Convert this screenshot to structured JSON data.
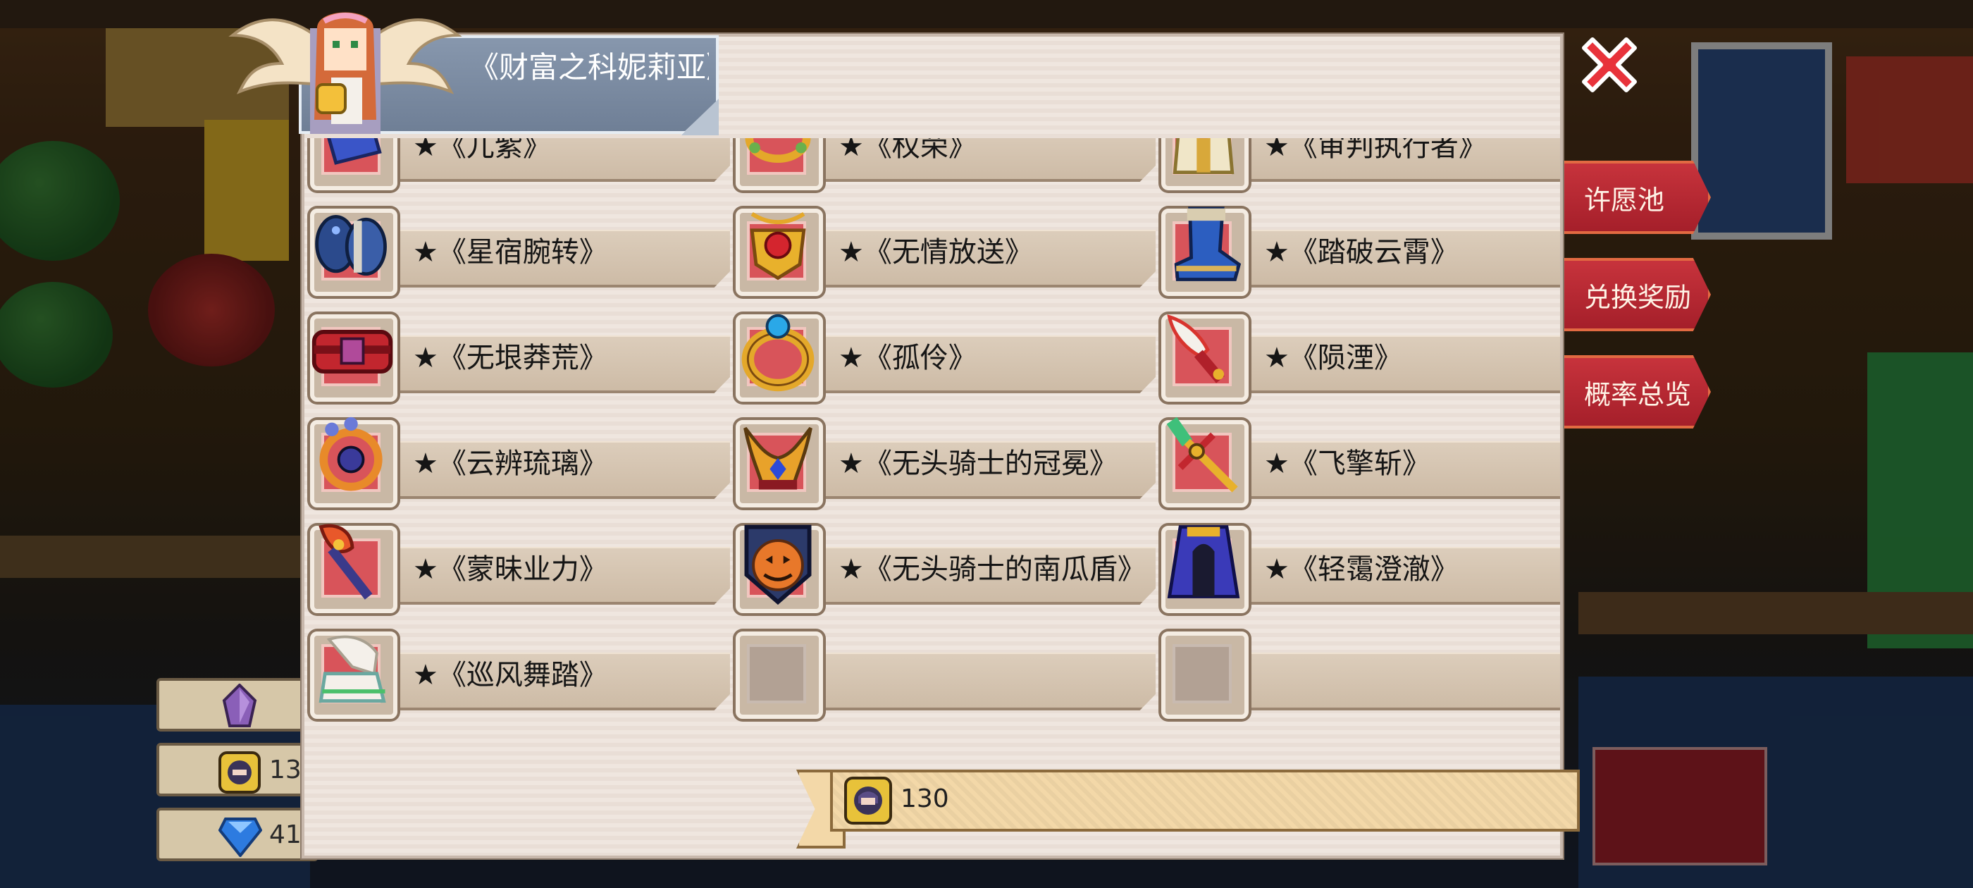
{
  "title": "《财富之科妮莉亚》",
  "side_buttons": [
    "许愿池",
    "兑换奖励",
    "概率总览"
  ],
  "resources": [
    {
      "icon": "purple-crystal-icon",
      "value": ""
    },
    {
      "icon": "coin-token-icon",
      "value": "13"
    },
    {
      "icon": "blue-gem-icon",
      "value": "41"
    }
  ],
  "items": [
    {
      "name": "★《兀紫》",
      "icon": "blue-lightning-fist-icon"
    },
    {
      "name": "★《权荣》",
      "icon": "golden-wreath-icon"
    },
    {
      "name": "★《审判执行者》",
      "icon": "armor-robe-icon"
    },
    {
      "name": "★《星宿腕转》",
      "icon": "blue-bracer-icon"
    },
    {
      "name": "★《无情放送》",
      "icon": "ruby-necklace-icon"
    },
    {
      "name": "★《踏破云霄》",
      "icon": "blue-boot-icon"
    },
    {
      "name": "★《无垠莽荒》",
      "icon": "red-belt-icon"
    },
    {
      "name": "★《孤伶》",
      "icon": "gold-ring-icon"
    },
    {
      "name": "★《陨湮》",
      "icon": "flame-dagger-icon"
    },
    {
      "name": "★《云辨琉璃》",
      "icon": "orange-amulet-icon"
    },
    {
      "name": "★《无头骑士的冠冕》",
      "icon": "horned-crown-icon"
    },
    {
      "name": "★《飞擎斩》",
      "icon": "jade-sword-icon"
    },
    {
      "name": "★《蒙昧业力》",
      "icon": "fire-staff-icon"
    },
    {
      "name": "★《无头骑士的南瓜盾》",
      "icon": "pumpkin-shield-icon"
    },
    {
      "name": "★《轻霭澄澈》",
      "icon": "blue-cloak-icon"
    },
    {
      "name": "★《巡风舞踏》",
      "icon": "winged-shoe-icon"
    },
    {
      "name": "",
      "icon": "empty-slot"
    },
    {
      "name": "",
      "icon": "empty-slot"
    }
  ],
  "cost": {
    "icon": "coin-token-icon",
    "value": "130"
  },
  "colors": {
    "accent_red": "#c7333c",
    "panel": "#efe6df",
    "banner": "#7f8fa6"
  }
}
